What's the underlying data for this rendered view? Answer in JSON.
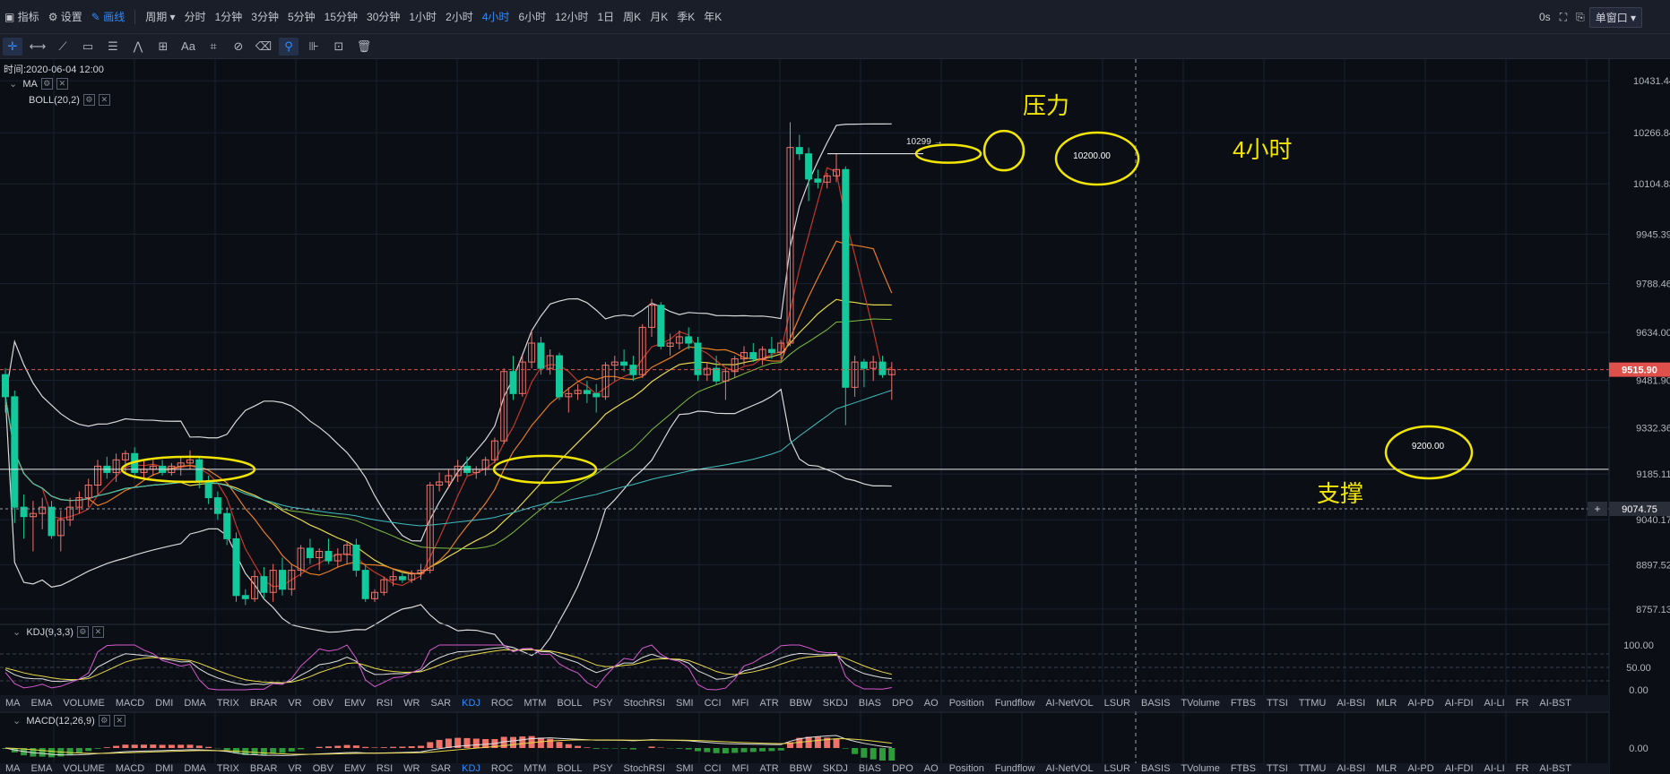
{
  "toolbar": {
    "indicator_label": "指标",
    "settings_label": "设置",
    "draw_label": "画线",
    "period_label": "周期",
    "periods": [
      "分时",
      "1分钟",
      "3分钟",
      "5分钟",
      "15分钟",
      "30分钟",
      "1小时",
      "2小时",
      "4小时",
      "6小时",
      "12小时",
      "1日",
      "周K",
      "月K",
      "季K",
      "年K"
    ],
    "active_period": "4小时",
    "countdown": "0s",
    "window_mode": "单窗口"
  },
  "drawing_tools": [
    "crosshair",
    "horizontal-ray",
    "trend-line",
    "rectangle",
    "parallel",
    "wave",
    "measure",
    "text",
    "fib",
    "brush",
    "eraser",
    "magnet",
    "lock",
    "hide",
    "delete"
  ],
  "legend": {
    "time": "时间:2020-06-04 12:00",
    "ma": "MA",
    "boll": "BOLL(20,2)",
    "kdj": "KDJ(9,3,3)",
    "macd": "MACD(12,26,9)"
  },
  "annotations": {
    "resistance": "压力",
    "support": "支撑",
    "timeframe": "4小时",
    "high_marker": "10299 →",
    "resistance_level": "10200.00",
    "support_level": "9200.00"
  },
  "price_axis": {
    "ticks": [
      "10431.44",
      "10266.84",
      "10104.83",
      "9945.39",
      "9788.46",
      "9634.00",
      "9481.90",
      "9332.36",
      "9185.11",
      "9040.17",
      "8897.52",
      "8757.13"
    ],
    "current_price": "9515.90",
    "crosshair_price": "9074.75",
    "crosshair_plus": "+"
  },
  "kdj_axis": [
    "100.00",
    "50.00",
    "0.00"
  ],
  "macd_axis": [
    "0.00"
  ],
  "indicators_row": [
    "MA",
    "EMA",
    "VOLUME",
    "MACD",
    "DMI",
    "DMA",
    "TRIX",
    "BRAR",
    "VR",
    "OBV",
    "EMV",
    "RSI",
    "WR",
    "SAR",
    "KDJ",
    "ROC",
    "MTM",
    "BOLL",
    "PSY",
    "StochRSI",
    "SMI",
    "CCI",
    "MFI",
    "ATR",
    "BBW",
    "SKDJ",
    "BIAS",
    "DPO",
    "AO",
    "Position",
    "Fundflow",
    "AI-NetVOL",
    "LSUR",
    "BASIS",
    "TVolume",
    "FTBS",
    "TTSI",
    "TTMU",
    "AI-BSI",
    "MLR",
    "AI-PD",
    "AI-FDI",
    "AI-LI",
    "FR",
    "AI-BST"
  ],
  "active_indicator": "KDJ",
  "chart_data": {
    "type": "candlestick",
    "timeframe": "4小时",
    "ylim": [
      8700,
      10500
    ],
    "resistance": 10200,
    "support": 9200,
    "current_price": 9515.9,
    "marked_high": 10299,
    "candles": [
      [
        9500,
        9520,
        9380,
        9430
      ],
      [
        9430,
        9450,
        9030,
        9080
      ],
      [
        9080,
        9120,
        8980,
        9050
      ],
      [
        9050,
        9100,
        8940,
        9060
      ],
      [
        9060,
        9110,
        9010,
        9080
      ],
      [
        9080,
        9100,
        8980,
        8990
      ],
      [
        8990,
        9070,
        8940,
        9040
      ],
      [
        9040,
        9110,
        9020,
        9080
      ],
      [
        9080,
        9130,
        9060,
        9110
      ],
      [
        9110,
        9170,
        9080,
        9150
      ],
      [
        9150,
        9230,
        9120,
        9210
      ],
      [
        9210,
        9240,
        9170,
        9190
      ],
      [
        9190,
        9250,
        9160,
        9230
      ],
      [
        9230,
        9260,
        9190,
        9250
      ],
      [
        9250,
        9270,
        9170,
        9190
      ],
      [
        9190,
        9230,
        9170,
        9200
      ],
      [
        9200,
        9230,
        9180,
        9210
      ],
      [
        9210,
        9230,
        9180,
        9190
      ],
      [
        9190,
        9220,
        9180,
        9210
      ],
      [
        9210,
        9240,
        9180,
        9220
      ],
      [
        9220,
        9260,
        9200,
        9230
      ],
      [
        9230,
        9240,
        9140,
        9160
      ],
      [
        9160,
        9180,
        9090,
        9110
      ],
      [
        9110,
        9130,
        9040,
        9060
      ],
      [
        9060,
        9080,
        8960,
        8980
      ],
      [
        8980,
        9000,
        8780,
        8800
      ],
      [
        8800,
        8820,
        8770,
        8790
      ],
      [
        8790,
        8880,
        8780,
        8860
      ],
      [
        8860,
        8890,
        8790,
        8810
      ],
      [
        8810,
        8900,
        8780,
        8880
      ],
      [
        8880,
        8920,
        8800,
        8820
      ],
      [
        8820,
        8900,
        8800,
        8880
      ],
      [
        8880,
        8960,
        8860,
        8950
      ],
      [
        8950,
        8980,
        8900,
        8920
      ],
      [
        8920,
        8950,
        8880,
        8940
      ],
      [
        8940,
        8980,
        8900,
        8910
      ],
      [
        8910,
        8950,
        8890,
        8930
      ],
      [
        8930,
        8970,
        8900,
        8960
      ],
      [
        8960,
        8980,
        8860,
        8880
      ],
      [
        8880,
        8900,
        8780,
        8790
      ],
      [
        8790,
        8820,
        8780,
        8810
      ],
      [
        8810,
        8860,
        8800,
        8850
      ],
      [
        8850,
        8880,
        8830,
        8860
      ],
      [
        8860,
        8870,
        8840,
        8850
      ],
      [
        8850,
        8880,
        8840,
        8870
      ],
      [
        8870,
        8900,
        8850,
        8880
      ],
      [
        8880,
        9160,
        8870,
        9150
      ],
      [
        9150,
        9190,
        9130,
        9160
      ],
      [
        9160,
        9200,
        9140,
        9180
      ],
      [
        9180,
        9230,
        9160,
        9210
      ],
      [
        9210,
        9240,
        9180,
        9190
      ],
      [
        9190,
        9210,
        9170,
        9200
      ],
      [
        9200,
        9240,
        9180,
        9230
      ],
      [
        9230,
        9300,
        9220,
        9290
      ],
      [
        9290,
        9520,
        9280,
        9510
      ],
      [
        9510,
        9560,
        9420,
        9440
      ],
      [
        9440,
        9560,
        9430,
        9540
      ],
      [
        9540,
        9640,
        9520,
        9600
      ],
      [
        9600,
        9620,
        9500,
        9520
      ],
      [
        9520,
        9580,
        9500,
        9560
      ],
      [
        9560,
        9570,
        9420,
        9430
      ],
      [
        9430,
        9460,
        9380,
        9440
      ],
      [
        9440,
        9470,
        9420,
        9450
      ],
      [
        9450,
        9480,
        9410,
        9440
      ],
      [
        9440,
        9470,
        9380,
        9430
      ],
      [
        9430,
        9540,
        9420,
        9530
      ],
      [
        9530,
        9560,
        9480,
        9540
      ],
      [
        9540,
        9580,
        9510,
        9530
      ],
      [
        9530,
        9560,
        9480,
        9500
      ],
      [
        9500,
        9660,
        9490,
        9650
      ],
      [
        9650,
        9740,
        9620,
        9720
      ],
      [
        9720,
        9730,
        9580,
        9590
      ],
      [
        9590,
        9630,
        9560,
        9600
      ],
      [
        9600,
        9640,
        9580,
        9620
      ],
      [
        9620,
        9650,
        9580,
        9600
      ],
      [
        9600,
        9620,
        9480,
        9500
      ],
      [
        9500,
        9540,
        9480,
        9520
      ],
      [
        9520,
        9560,
        9470,
        9480
      ],
      [
        9480,
        9520,
        9420,
        9510
      ],
      [
        9510,
        9560,
        9490,
        9550
      ],
      [
        9550,
        9590,
        9530,
        9570
      ],
      [
        9570,
        9600,
        9540,
        9550
      ],
      [
        9550,
        9590,
        9530,
        9580
      ],
      [
        9580,
        9620,
        9550,
        9570
      ],
      [
        9570,
        9610,
        9550,
        9600
      ],
      [
        9600,
        10300,
        9590,
        10220
      ],
      [
        10220,
        10260,
        10180,
        10200
      ],
      [
        10200,
        10220,
        10050,
        10120
      ],
      [
        10120,
        10150,
        10090,
        10110
      ],
      [
        10110,
        10140,
        10090,
        10130
      ],
      [
        10130,
        10200,
        10110,
        10150
      ],
      [
        10150,
        10160,
        9340,
        9460
      ],
      [
        9460,
        9560,
        9430,
        9540
      ],
      [
        9540,
        9550,
        9460,
        9520
      ],
      [
        9520,
        9560,
        9480,
        9540
      ],
      [
        9540,
        9560,
        9490,
        9500
      ],
      [
        9500,
        9540,
        9420,
        9515.9
      ]
    ]
  }
}
